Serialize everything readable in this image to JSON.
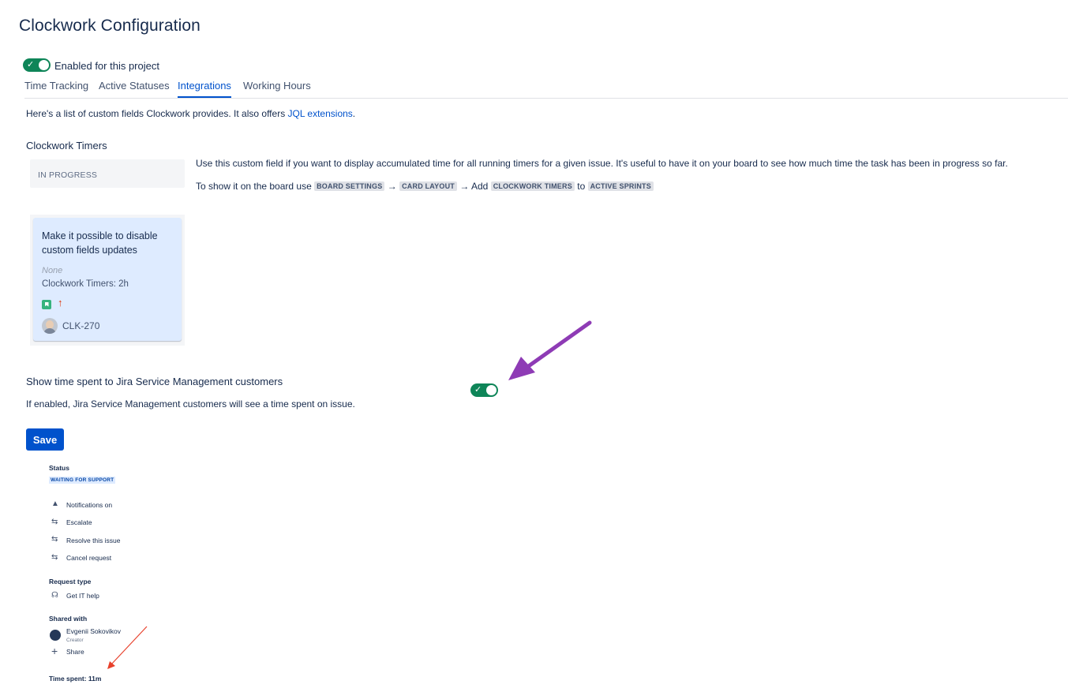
{
  "page": {
    "title": "Clockwork Configuration",
    "enabled_label": "Enabled for this project",
    "enabled": true
  },
  "tabs": [
    {
      "label": "Time Tracking",
      "active": false
    },
    {
      "label": "Active Statuses",
      "active": false
    },
    {
      "label": "Integrations",
      "active": true
    },
    {
      "label": "Working Hours",
      "active": false
    }
  ],
  "intro": {
    "text": "Here's a list of custom fields Clockwork provides. It also offers ",
    "link": "JQL extensions",
    "suffix": "."
  },
  "timers_section": {
    "title": "Clockwork Timers",
    "description": "Use this custom field if you want to display accumulated time for all running timers for a given issue. It's useful to have it on your board to see how much time the task has been in progress so far.",
    "instruction_prefix": "To show it on the board use",
    "board_settings": "BOARD SETTINGS",
    "arrow1": "→",
    "card_layout": "CARD LAYOUT",
    "arrow2": "→ Add",
    "clockwork_timers": "CLOCKWORK TIMERS",
    "to": "to",
    "active_sprints": "ACTIVE SPRINTS",
    "column_name": "IN PROGRESS",
    "card": {
      "title": "Make it possible to disable custom fields updates",
      "field_none": "None",
      "timers_value": "Clockwork Timers: 2h",
      "key": "CLK-270",
      "priority_icon": "arrow-up-icon",
      "type_icon": "story-icon"
    }
  },
  "jsm_section": {
    "title": "Show time spent to Jira Service Management customers",
    "description": "If enabled, Jira Service Management customers will see a time spent on issue.",
    "enabled": true
  },
  "save_label": "Save",
  "customer_view": {
    "status_label": "Status",
    "status_value": "WAITING FOR SUPPORT",
    "actions": [
      "Notifications on",
      "Escalate",
      "Resolve this issue",
      "Cancel request"
    ],
    "request_type_label": "Request type",
    "request_type_value": "Get IT help",
    "shared_with_label": "Shared with",
    "shared_user": "Evgenii Sokovikov",
    "shared_role": "Creator",
    "share_label": "Share",
    "time_spent": "Time spent: 11m"
  },
  "colors": {
    "primary": "#0052cc",
    "toggle_on": "#0e8558",
    "card_bg": "#deebff",
    "annotation_arrow": "#8e3bb5",
    "annotation_arrow_small": "#e8412c"
  }
}
